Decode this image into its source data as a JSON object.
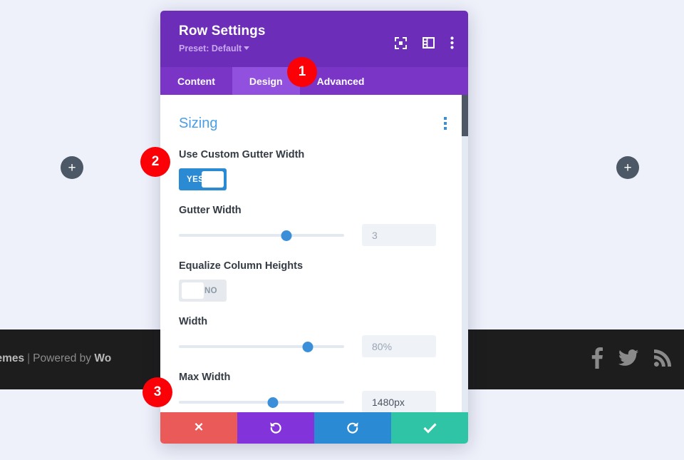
{
  "page": {
    "footer": {
      "text_clipped_prefix": "ant Themes",
      "separator": "|",
      "powered_by": "Powered by",
      "brand_clipped": "Wo",
      "social_icons": [
        "facebook-icon",
        "twitter-icon",
        "rss-icon"
      ]
    },
    "add_buttons": {
      "label": "+",
      "left_name": "add-module-left",
      "right_name": "add-module-right"
    }
  },
  "modal": {
    "title": "Row Settings",
    "preset_label": "Preset: Default",
    "header_icons": [
      "fullscreen-icon",
      "layout-view-icon",
      "kebab-menu-icon"
    ],
    "tabs": [
      {
        "label": "Content",
        "active": false
      },
      {
        "label": "Design",
        "active": true
      },
      {
        "label": "Advanced",
        "active": false
      }
    ],
    "section": {
      "title": "Sizing",
      "menu_icon": "kebab-menu-icon"
    },
    "fields": [
      {
        "type": "toggle",
        "label": "Use Custom Gutter Width",
        "state": "YES",
        "on": true
      },
      {
        "type": "slider",
        "label": "Gutter Width",
        "value": "3",
        "handle_pct": 65,
        "filled": false
      },
      {
        "type": "toggle",
        "label": "Equalize Column Heights",
        "state": "NO",
        "on": false
      },
      {
        "type": "slider",
        "label": "Width",
        "value": "80%",
        "handle_pct": 78,
        "filled": false
      },
      {
        "type": "slider",
        "label": "Max Width",
        "value": "1480px",
        "handle_pct": 57,
        "filled": true
      }
    ],
    "actions": [
      {
        "name": "close-button",
        "icon": "x-icon"
      },
      {
        "name": "undo-button",
        "icon": "undo-icon"
      },
      {
        "name": "redo-button",
        "icon": "redo-icon"
      },
      {
        "name": "save-button",
        "icon": "check-icon"
      }
    ]
  },
  "annotations": [
    {
      "number": "1"
    },
    {
      "number": "2"
    },
    {
      "number": "3"
    }
  ],
  "colors": {
    "header_purple": "#6c2eb9",
    "tab_bar_purple": "#7a35c6",
    "tab_active_purple": "#9150de",
    "accent_blue": "#3a8fd8",
    "section_title_blue": "#4a9ee8",
    "badge_red": "#fb0007",
    "page_bg": "#eef1fa",
    "footer_dark": "#1d1d1d",
    "act_close": "#ea5a58",
    "act_undo": "#8233da",
    "act_redo": "#2a8ad4",
    "act_save": "#2ec4a5"
  }
}
